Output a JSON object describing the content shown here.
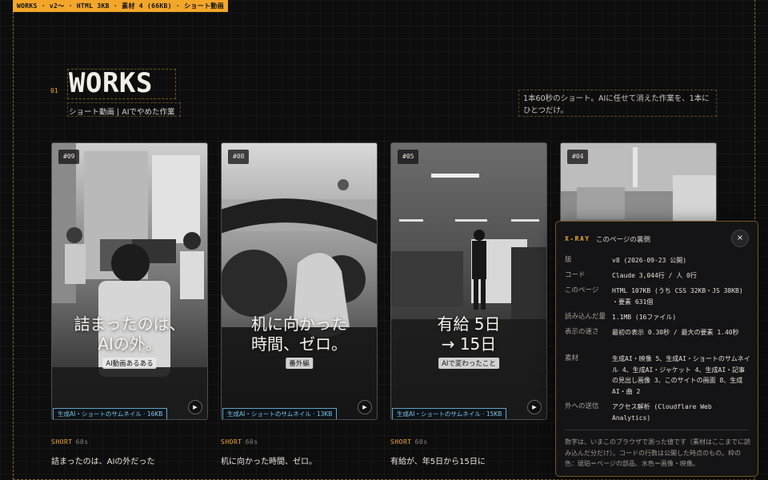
{
  "topbar": "WORKS · v2〜 · HTML 3KB · 素材 4 (66KB) · ショート動画",
  "section_num": "01",
  "title": "WORKS",
  "subtitle": "ショート動画 | AIでやめた作業",
  "lead": "1本60秒のショート。AIに任せて消えた作業を、1本にひとつだけ。",
  "cards": [
    {
      "tag": "#09",
      "headline1": "詰まったのは、",
      "headline2": "AIの外。",
      "badge": "AI動画あるある",
      "caption": "生成AI・ショートのサムネイル · 16KB",
      "play": "▶",
      "kind": "SHORT",
      "duration": "60s",
      "title": "詰まったのは、AIの外だった"
    },
    {
      "tag": "#08",
      "headline1": "机に向かった",
      "headline2": "時間、ゼロ。",
      "badge": "番外編",
      "caption": "生成AI・ショートのサムネイル · 13KB",
      "play": "▶",
      "kind": "SHORT",
      "duration": "60s",
      "title": "机に向かった時間、ゼロ。"
    },
    {
      "tag": "#05",
      "headline1": "有給 5日",
      "headline2": "→ 15日",
      "badge": "AIで変わったこと",
      "caption": "生成AI・ショートのサムネイル · 15KB",
      "play": "▶",
      "kind": "SHORT",
      "duration": "60s",
      "title": "有給が、年5日から15日に"
    },
    {
      "tag": "#04"
    }
  ],
  "xray": {
    "label": "X-RAY",
    "heading": "このページの裏側",
    "close": "×",
    "rows": [
      {
        "key": "版",
        "value": "v8 (2026-09-23 公開)"
      },
      {
        "key": "コード",
        "value": "Claude 3,044行 / 人 0行"
      },
      {
        "key": "このページ",
        "value": "HTML 107KB (うち CSS 32KB・JS 38KB) ・要素 631個"
      },
      {
        "key": "読み込んだ量",
        "value": "1.1MB (16ファイル)"
      },
      {
        "key": "表示の速さ",
        "value": "最初の表示 0.30秒 / 最大の要素 1.40秒"
      },
      {
        "key": "素材",
        "value": "生成AI・映像 5、生成AI・ショートのサムネイル 4、生成AI・ジャケット 4、生成AI・記事の見出し画像 3、このサイトの画面 8、生成AI・曲 2"
      },
      {
        "key": "外への送信",
        "value": "アクセス解析 (Cloudflare Web Analytics)"
      }
    ],
    "note": "数字は、いまこのブラウザで測った値です（素材はここまでに読み込んだ分だけ）。コードの行数は公開した時点のもの。枠の色：琥珀＝ページの部品、水色＝画像・映像。"
  }
}
